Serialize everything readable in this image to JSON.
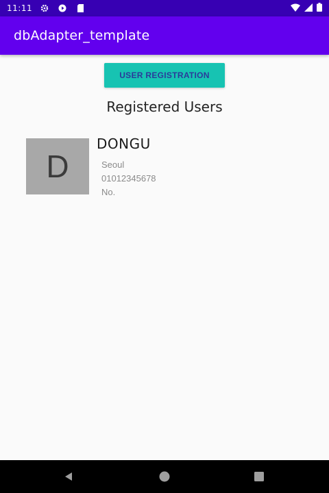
{
  "status_bar": {
    "time": "11:11",
    "icons": [
      "gear-icon",
      "play-icon",
      "sd-card-icon",
      "wifi-icon",
      "signal-icon",
      "battery-icon"
    ]
  },
  "app_bar": {
    "title": "dbAdapter_template",
    "color": "#6200ee"
  },
  "main": {
    "register_button_label": "USER REGISTRATION",
    "section_title": "Registered Users",
    "users": [
      {
        "avatar_letter": "D",
        "name": "DONGU",
        "city": "Seoul",
        "phone": "01012345678",
        "extra": "No."
      }
    ]
  },
  "nav_bar": {
    "buttons": [
      "back-icon",
      "home-icon",
      "recents-icon"
    ]
  },
  "colors": {
    "status_bar": "#3700b3",
    "accent_button": "#17c3b2",
    "avatar_bg": "#a8a8a8"
  }
}
